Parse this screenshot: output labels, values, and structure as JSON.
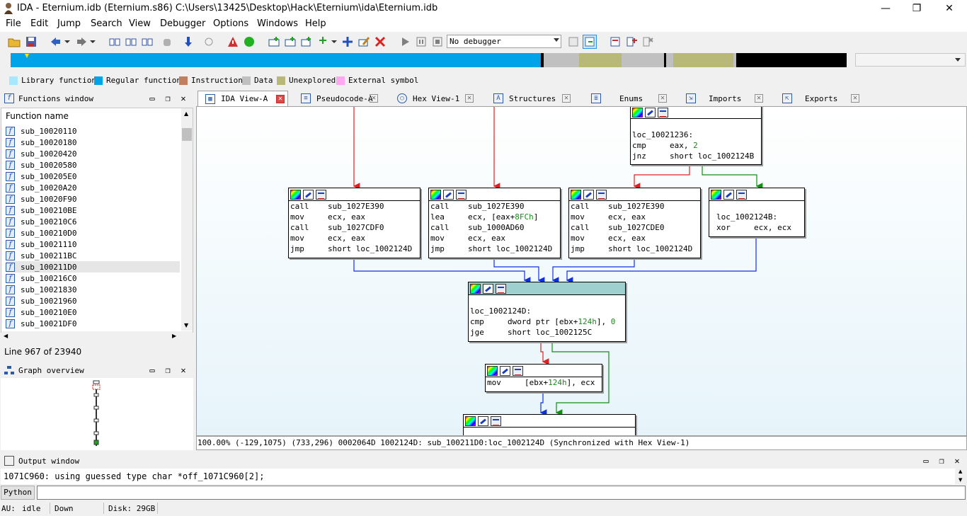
{
  "window": {
    "title": "IDA - Eternium.idb (Eternium.s86) C:\\Users\\13425\\Desktop\\Hack\\Eternium\\ida\\Eternium.idb",
    "minimize": "—",
    "maximize": "❐",
    "close": "✕"
  },
  "menu": [
    "File",
    "Edit",
    "Jump",
    "Search",
    "View",
    "Debugger",
    "Options",
    "Windows",
    "Help"
  ],
  "toolbar": {
    "debugger_value": "No debugger"
  },
  "legend": [
    {
      "label": "Library function",
      "color": "#a8e8ff"
    },
    {
      "label": "Regular function",
      "color": "#00a2e8"
    },
    {
      "label": "Instruction",
      "color": "#c08060"
    },
    {
      "label": "Data",
      "color": "#c0c0c0"
    },
    {
      "label": "Unexplored",
      "color": "#b8b878"
    },
    {
      "label": "External symbol",
      "color": "#ffa8f0"
    }
  ],
  "functions_window": {
    "title": "Functions window",
    "header": "Function name",
    "items": [
      "sub_10020110",
      "sub_10020180",
      "sub_10020420",
      "sub_10020580",
      "sub_100205E0",
      "sub_10020A20",
      "sub_10020F90",
      "sub_100210BE",
      "sub_100210C6",
      "sub_100210D0",
      "sub_10021110",
      "sub_100211BC",
      "sub_100211D0",
      "sub_100216C0",
      "sub_10021830",
      "sub_10021960",
      "sub_100210E0",
      "sub_10021DF0"
    ],
    "selected_index": 12,
    "status": "Line 967 of 23940"
  },
  "graph_overview": {
    "title": "Graph overview"
  },
  "tabs": [
    {
      "label": "IDA View-A",
      "active": true
    },
    {
      "label": "Pseudocode-A",
      "active": false
    },
    {
      "label": "Hex View-1",
      "active": false
    },
    {
      "label": "Structures",
      "active": false
    },
    {
      "label": "Enums",
      "active": false
    },
    {
      "label": "Imports",
      "active": false
    },
    {
      "label": "Exports",
      "active": false
    }
  ],
  "graph": {
    "node_top": {
      "lines": [
        "",
        "loc_10021236:",
        "cmp     eax, 2",
        "jnz     short loc_1002124B"
      ]
    },
    "node_a": {
      "lines": [
        "call    sub_1027E390",
        "mov     ecx, eax",
        "call    sub_1027CDF0",
        "mov     ecx, eax",
        "jmp     short loc_1002124D"
      ]
    },
    "node_b": {
      "lines": [
        "call    sub_1027E390",
        "lea     ecx, [eax+8FCh]",
        "call    sub_1000AD60",
        "mov     ecx, eax",
        "jmp     short loc_1002124D"
      ]
    },
    "node_c": {
      "lines": [
        "call    sub_1027E390",
        "mov     ecx, eax",
        "call    sub_1027CDE0",
        "mov     ecx, eax",
        "jmp     short loc_1002124D"
      ]
    },
    "node_d": {
      "lines": [
        "",
        "loc_1002124B:",
        "xor     ecx, ecx"
      ]
    },
    "node_merge": {
      "lines": [
        "",
        "loc_1002124D:",
        "cmp     dword ptr [ebx+124h], 0",
        "jge     short loc_1002125C"
      ]
    },
    "node_mov": {
      "lines": [
        "mov     [ebx+124h], ecx"
      ]
    },
    "status": "100.00% (-129,1075) (733,296) 0002064D 1002124D: sub_100211D0:loc_1002124D (Synchronized with Hex View-1)"
  },
  "output_window": {
    "title": "Output window",
    "text": "1071C960: using guessed type char *off_1071C960[2];",
    "python_label": "Python"
  },
  "statusbar": {
    "au_label": "AU:",
    "au_state": "idle",
    "direction": "Down",
    "disk": "Disk: 29GB"
  }
}
